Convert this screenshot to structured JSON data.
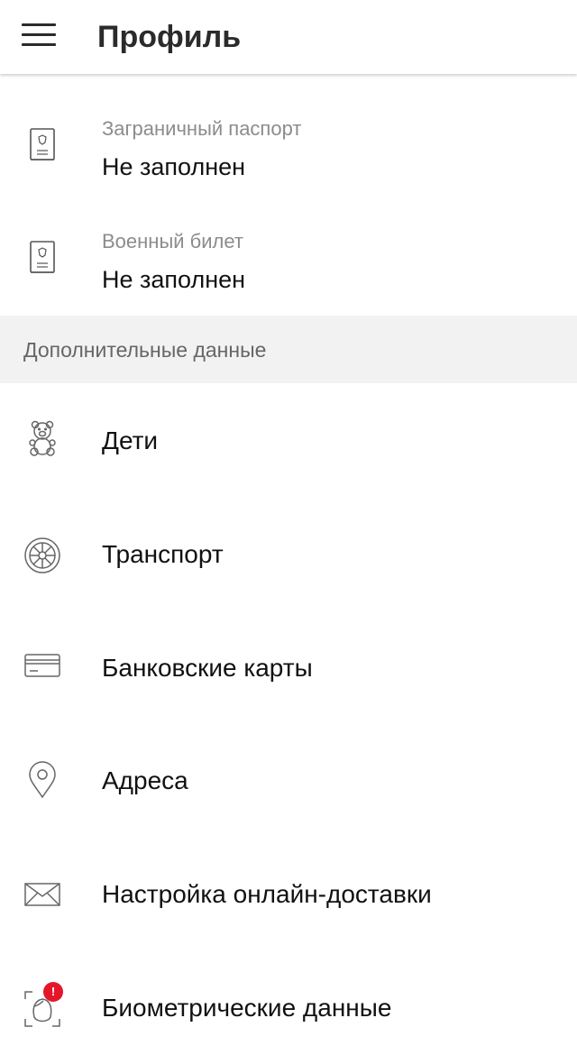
{
  "appbar": {
    "title": "Профиль",
    "menu_icon": "hamburger-icon"
  },
  "documents": [
    {
      "label": "Заграничный паспорт",
      "value": "Не заполнен",
      "icon": "passport-icon"
    },
    {
      "label": "Военный билет",
      "value": "Не заполнен",
      "icon": "military-id-icon"
    }
  ],
  "section": {
    "title": "Дополнительные данные"
  },
  "menu": [
    {
      "label": "Дети",
      "icon": "teddy-bear-icon"
    },
    {
      "label": "Транспорт",
      "icon": "wheel-icon"
    },
    {
      "label": "Банковские карты",
      "icon": "bank-card-icon"
    },
    {
      "label": "Адреса",
      "icon": "location-pin-icon"
    },
    {
      "label": "Настройка онлайн-доставки",
      "icon": "envelope-icon"
    },
    {
      "label": "Биометрические данные",
      "icon": "face-scan-icon",
      "badge": "!"
    }
  ],
  "colors": {
    "badge": "#e4172a",
    "section_bg": "#f2f2f2",
    "muted_text": "#8c8c8c"
  }
}
